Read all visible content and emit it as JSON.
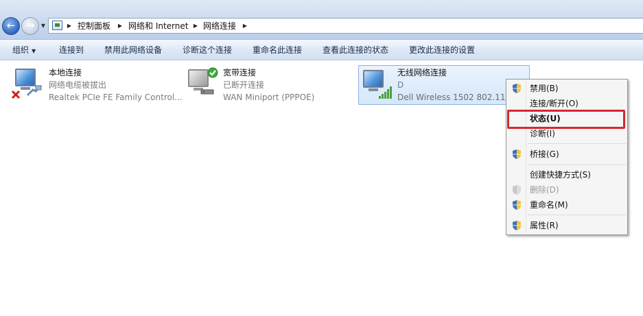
{
  "address_bar": {
    "crumbs": [
      "控制面板",
      "网络和 Internet",
      "网络连接"
    ]
  },
  "toolbar": {
    "organize": "组织",
    "items": [
      "连接到",
      "禁用此网络设备",
      "诊断这个连接",
      "重命名此连接",
      "查看此连接的状态",
      "更改此连接的设置"
    ]
  },
  "connections": [
    {
      "name": "本地连接",
      "status": "网络电缆被拔出",
      "device": "Realtek PCIe FE Family Control...",
      "icon": "wired-network-disconnected-icon"
    },
    {
      "name": "宽带连接",
      "status": "已断开连接",
      "device": "WAN Miniport (PPPOE)",
      "icon": "broadband-connection-icon"
    },
    {
      "name": "无线网络连接",
      "status": "D",
      "device": "Dell Wireless 1502 802.11b/",
      "icon": "wireless-network-icon"
    }
  ],
  "context_menu": {
    "items": [
      {
        "label": "禁用(B)",
        "shield": true,
        "disabled": false,
        "bold": false
      },
      {
        "label": "连接/断开(O)",
        "shield": false,
        "disabled": false,
        "bold": false
      },
      {
        "label": "状态(U)",
        "shield": false,
        "disabled": false,
        "bold": true
      },
      {
        "label": "诊断(I)",
        "shield": false,
        "disabled": false,
        "bold": false
      },
      {
        "label": "桥接(G)",
        "shield": true,
        "disabled": false,
        "bold": false
      },
      {
        "label": "创建快捷方式(S)",
        "shield": false,
        "disabled": false,
        "bold": false
      },
      {
        "label": "删除(D)",
        "shield": true,
        "disabled": true,
        "bold": false
      },
      {
        "label": "重命名(M)",
        "shield": true,
        "disabled": false,
        "bold": false
      },
      {
        "label": "属性(R)",
        "shield": true,
        "disabled": false,
        "bold": false
      }
    ]
  },
  "colors": {
    "highlight": "#d8262c",
    "selection_border": "#8db2e3",
    "accent": "#2e66c1"
  }
}
